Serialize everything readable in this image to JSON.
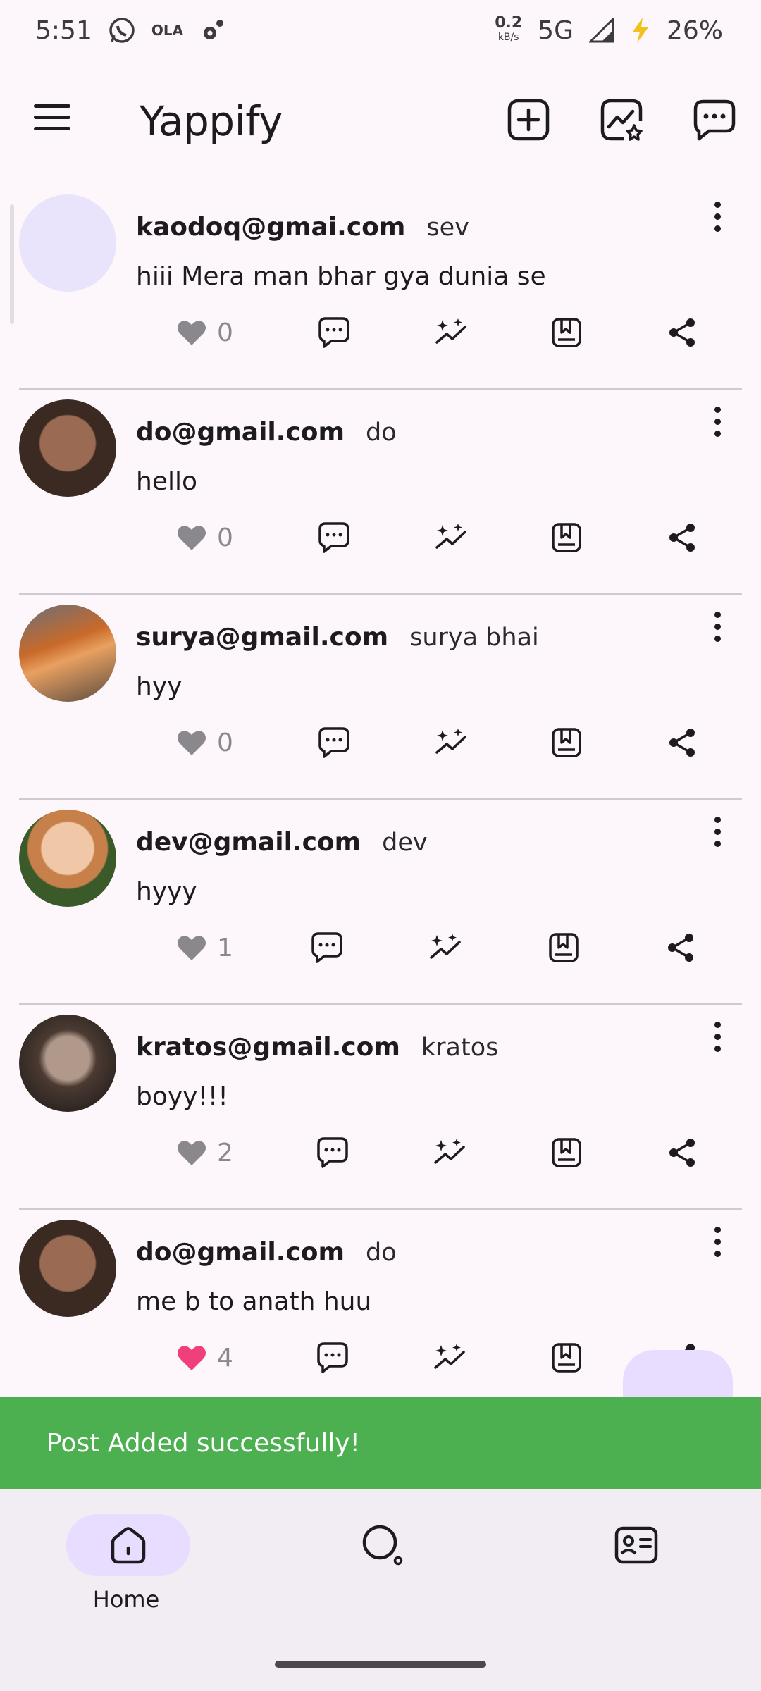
{
  "status_bar": {
    "time": "5:51",
    "icons": [
      "whatsapp-icon",
      "ola-icon",
      "settings-icon"
    ],
    "ola_text": "OLA",
    "speed_value": "0.2",
    "speed_unit": "kB/s",
    "network": "5G",
    "battery": "26%"
  },
  "app_bar": {
    "title": "Yappify",
    "actions": [
      "add-post-icon",
      "trending-icon",
      "chat-icon"
    ]
  },
  "posts": [
    {
      "email": "kaodoq@gmai.com",
      "name": "sev",
      "text": "hiii Mera man bhar gya dunia se",
      "likes": "0",
      "liked": false
    },
    {
      "email": "do@gmail.com",
      "name": "do",
      "text": "hello",
      "likes": "0",
      "liked": false
    },
    {
      "email": "surya@gmail.com",
      "name": "surya bhai",
      "text": "hyy",
      "likes": "0",
      "liked": false
    },
    {
      "email": "dev@gmail.com",
      "name": "dev",
      "text": "hyyy",
      "likes": "1",
      "liked": false
    },
    {
      "email": "kratos@gmail.com",
      "name": "kratos",
      "text": "boyy!!!",
      "likes": "2",
      "liked": false
    },
    {
      "email": "do@gmail.com",
      "name": "do",
      "text": "me b to anath huu",
      "likes": "4",
      "liked": true
    }
  ],
  "snackbar": {
    "message": "Post Added successfully!"
  },
  "bottom_nav": {
    "items": [
      {
        "label": "Home",
        "icon": "home-icon",
        "active": true
      },
      {
        "label": "",
        "icon": "search-icon",
        "active": false
      },
      {
        "label": "",
        "icon": "profile-card-icon",
        "active": false
      }
    ]
  },
  "colors": {
    "background": "#fdf7fc",
    "snackbar": "#4caf50",
    "like_active": "#f0407a",
    "like_inactive": "#8a878d",
    "nav_pill": "#e8ddff"
  }
}
